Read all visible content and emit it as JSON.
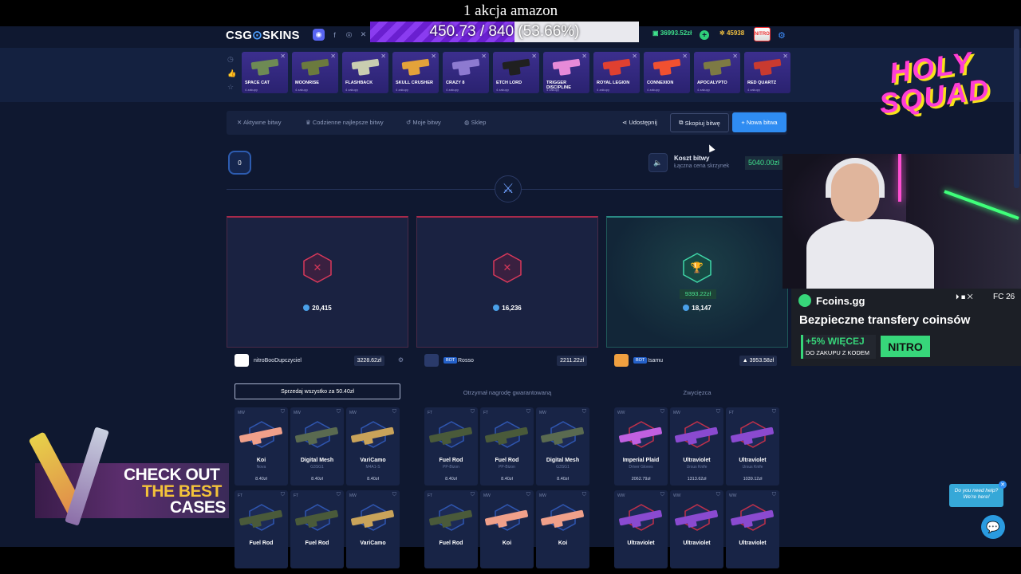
{
  "stream": {
    "goal_title": "1 akcja amazon",
    "goal_progress_text": "450.73 / 840 (53.66%)",
    "goal_fraction": 0.5366
  },
  "header": {
    "logo_left": "CSG",
    "logo_right": "SKINS",
    "balance": "36993.52zł",
    "points": "45938",
    "avatar_text": "NITRO"
  },
  "cases": [
    {
      "name": "SPACE CAT",
      "sub": "4 zakupy",
      "color": "#6e8a54"
    },
    {
      "name": "MOONRISE",
      "sub": "4 zakupy",
      "color": "#6b7a3e"
    },
    {
      "name": "FLASHBACK",
      "sub": "4 zakupy",
      "color": "#c9cdb0"
    },
    {
      "name": "SKULL CRUSHER",
      "sub": "4 zakupy",
      "color": "#e3a23a"
    },
    {
      "name": "CRAZY 8",
      "sub": "4 zakupy",
      "color": "#8d7ad0"
    },
    {
      "name": "ETCH LORD",
      "sub": "4 zakupy",
      "color": "#202020"
    },
    {
      "name": "TRIGGER DISCIPLINE",
      "sub": "4 zakupy",
      "color": "#e68ad8"
    },
    {
      "name": "ROYAL LEGION",
      "sub": "4 zakupy",
      "color": "#e04030"
    },
    {
      "name": "CONNEXION",
      "sub": "4 zakupy",
      "color": "#f05030"
    },
    {
      "name": "APOCALYPTO",
      "sub": "4 zakupy",
      "color": "#7d7a44"
    },
    {
      "name": "RED QUARTZ",
      "sub": "4 zakupy",
      "color": "#c83a30"
    }
  ],
  "nav": {
    "active": "Aktywne bitwy",
    "daily": "Codzienne najlepsze bitwy",
    "mine": "Moje bitwy",
    "shop": "Sklep",
    "share": "Udostępnij",
    "copy": "Skopiuj bitwę",
    "new": "+ Nowa bitwa"
  },
  "battle": {
    "round": "0",
    "cost_label": "Koszt bitwy",
    "cost_sub": "Łączna cena skrzynek",
    "cost_value": "5040.00zł"
  },
  "players": [
    {
      "coins": "20,415",
      "name": "nitroBooDupczyciel",
      "total": "3228.62zł",
      "bot": "",
      "status": "",
      "action": "Sprzedaj wszystko za 50.40zł",
      "winner": false,
      "avatar_color": "#ffffff",
      "items": [
        {
          "cond": "MW",
          "name": "Koi",
          "sub": "Nova",
          "price": "8.40zł",
          "color": "#f0a08a"
        },
        {
          "cond": "MW",
          "name": "Digital Mesh",
          "sub": "G3SG1",
          "price": "8.40zł",
          "color": "#5a6a50"
        },
        {
          "cond": "MW",
          "name": "VariCamo",
          "sub": "M4A1-S",
          "price": "8.40zł",
          "color": "#c9a35a"
        },
        {
          "cond": "FT",
          "name": "Fuel Rod",
          "sub": "",
          "price": "",
          "color": "#4a5a3a"
        },
        {
          "cond": "FT",
          "name": "Fuel Rod",
          "sub": "",
          "price": "",
          "color": "#4a5a3a"
        },
        {
          "cond": "MW",
          "name": "VariCamo",
          "sub": "",
          "price": "",
          "color": "#c9a35a"
        }
      ]
    },
    {
      "coins": "16,236",
      "name": "Rosso",
      "total": "2211.22zł",
      "bot": "BOT",
      "status": "Otrzymał nagrodę gwarantowaną",
      "action": "",
      "winner": false,
      "avatar_color": "#2a3a6a",
      "items": [
        {
          "cond": "FT",
          "name": "Fuel Rod",
          "sub": "PP-Bizon",
          "price": "8.40zł",
          "color": "#4a5a3a"
        },
        {
          "cond": "FT",
          "name": "Fuel Rod",
          "sub": "PP-Bizon",
          "price": "8.40zł",
          "color": "#4a5a3a"
        },
        {
          "cond": "MW",
          "name": "Digital Mesh",
          "sub": "G3SG1",
          "price": "8.40zł",
          "color": "#5a6a50"
        },
        {
          "cond": "FT",
          "name": "Fuel Rod",
          "sub": "",
          "price": "",
          "color": "#4a5a3a"
        },
        {
          "cond": "MW",
          "name": "Koi",
          "sub": "",
          "price": "",
          "color": "#f0a08a"
        },
        {
          "cond": "MW",
          "name": "Koi",
          "sub": "",
          "price": "",
          "color": "#f0a08a"
        }
      ]
    },
    {
      "coins": "18,147",
      "name": "Isamu",
      "total": "3953.58zł",
      "bot": "BOT",
      "status": "Zwycięzca",
      "action": "",
      "winner": true,
      "win_amount": "9393.22zł",
      "avatar_color": "#f0a040",
      "items": [
        {
          "cond": "WW",
          "name": "Imperial Plaid",
          "sub": "Driver Gloves",
          "price": "2062.79zł",
          "color": "#c060e0"
        },
        {
          "cond": "MW",
          "name": "Ultraviolet",
          "sub": "Ursus Knife",
          "price": "1313.62zł",
          "color": "#8a4ad0"
        },
        {
          "cond": "FT",
          "name": "Ultraviolet",
          "sub": "Ursus Knife",
          "price": "1039.12zł",
          "color": "#8a4ad0"
        },
        {
          "cond": "WW",
          "name": "Ultraviolet",
          "sub": "",
          "price": "",
          "color": "#8a4ad0"
        },
        {
          "cond": "WW",
          "name": "Ultraviolet",
          "sub": "",
          "price": "",
          "color": "#8a4ad0"
        },
        {
          "cond": "WW",
          "name": "Ultraviolet",
          "sub": "",
          "price": "",
          "color": "#8a4ad0"
        }
      ]
    }
  ],
  "left_ad": {
    "line1": "CHECK OUT",
    "line2": "THE BEST",
    "line3": "CASES"
  },
  "overlay": {
    "logo_line1": "HOLY",
    "logo_line2": "SQUAD"
  },
  "fcoins": {
    "name": "Fcoins.gg",
    "fc": "FC 26",
    "platforms": "⏵ ◼ ✕",
    "title": "Bezpieczne transfery coinsów",
    "promo1": "+5% WIĘCEJ",
    "promo2": "DO ZAKUPU Z KODEM",
    "code": "NITRO"
  },
  "help": {
    "line1": "Do you need help?",
    "line2": "We're here!"
  }
}
